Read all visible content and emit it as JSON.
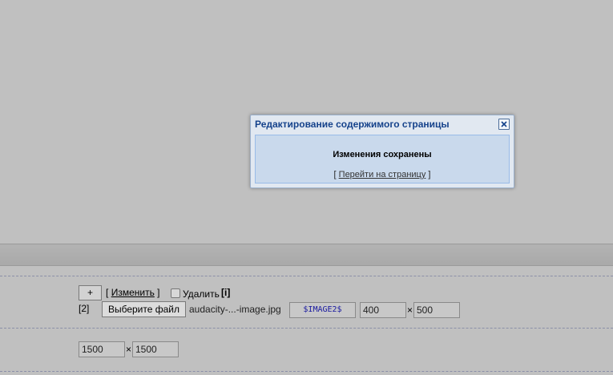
{
  "modal": {
    "title": "Редактирование содержимого страницы",
    "message": "Изменения сохранены",
    "link_open": "[",
    "link_text": "Перейти на страницу",
    "link_close": "]"
  },
  "form": {
    "add_button": "+",
    "edit_bracket_open": "[",
    "edit_link": "Изменить",
    "edit_bracket_close": "]",
    "delete_label": "Удалить",
    "info_tag": "[i]",
    "image_index": "[2]",
    "choose_file_button": "Выберите файл",
    "file_name": "audacity-...-image.jpg",
    "image_code": "$IMAGE2$",
    "width_value": "400",
    "height_value": "500",
    "max_width_value": "1500",
    "max_height_value": "1500",
    "times_symbol": "×"
  }
}
